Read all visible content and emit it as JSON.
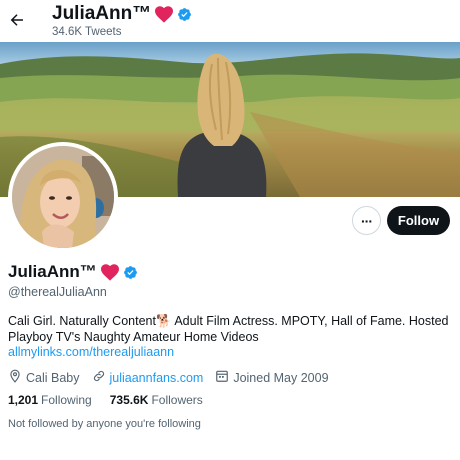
{
  "header": {
    "display_name": "JuliaAnn™",
    "tweet_count": "34.6K Tweets"
  },
  "profile": {
    "display_name": "JuliaAnn™",
    "handle": "@therealJuliaAnn",
    "bio_part1": "Cali Girl. Naturally Content",
    "bio_emoji": "🐕",
    "bio_part2": " Adult Film Actress. MPOTY, Hall of Fame. Hosted Playboy TV's Naughty Amateur Home Videos",
    "bio_link": "allmylinks.com/therealjuliaann",
    "location": "Cali Baby",
    "website": "juliaannfans.com",
    "joined": "Joined May 2009",
    "following_count": "1,201",
    "following_label": "Following",
    "followers_count": "735.6K",
    "followers_label": "Followers",
    "not_followed_text": "Not followed by anyone you're following"
  },
  "actions": {
    "more_label": "···",
    "follow_label": "Follow"
  },
  "colors": {
    "accent": "#1d9bf0",
    "heart": "#e0245e",
    "follow_bg": "#0f1419"
  },
  "icons": [
    "back-arrow-icon",
    "heart-icon",
    "verified-badge-icon",
    "more-icon",
    "location-icon",
    "link-icon",
    "calendar-icon"
  ]
}
